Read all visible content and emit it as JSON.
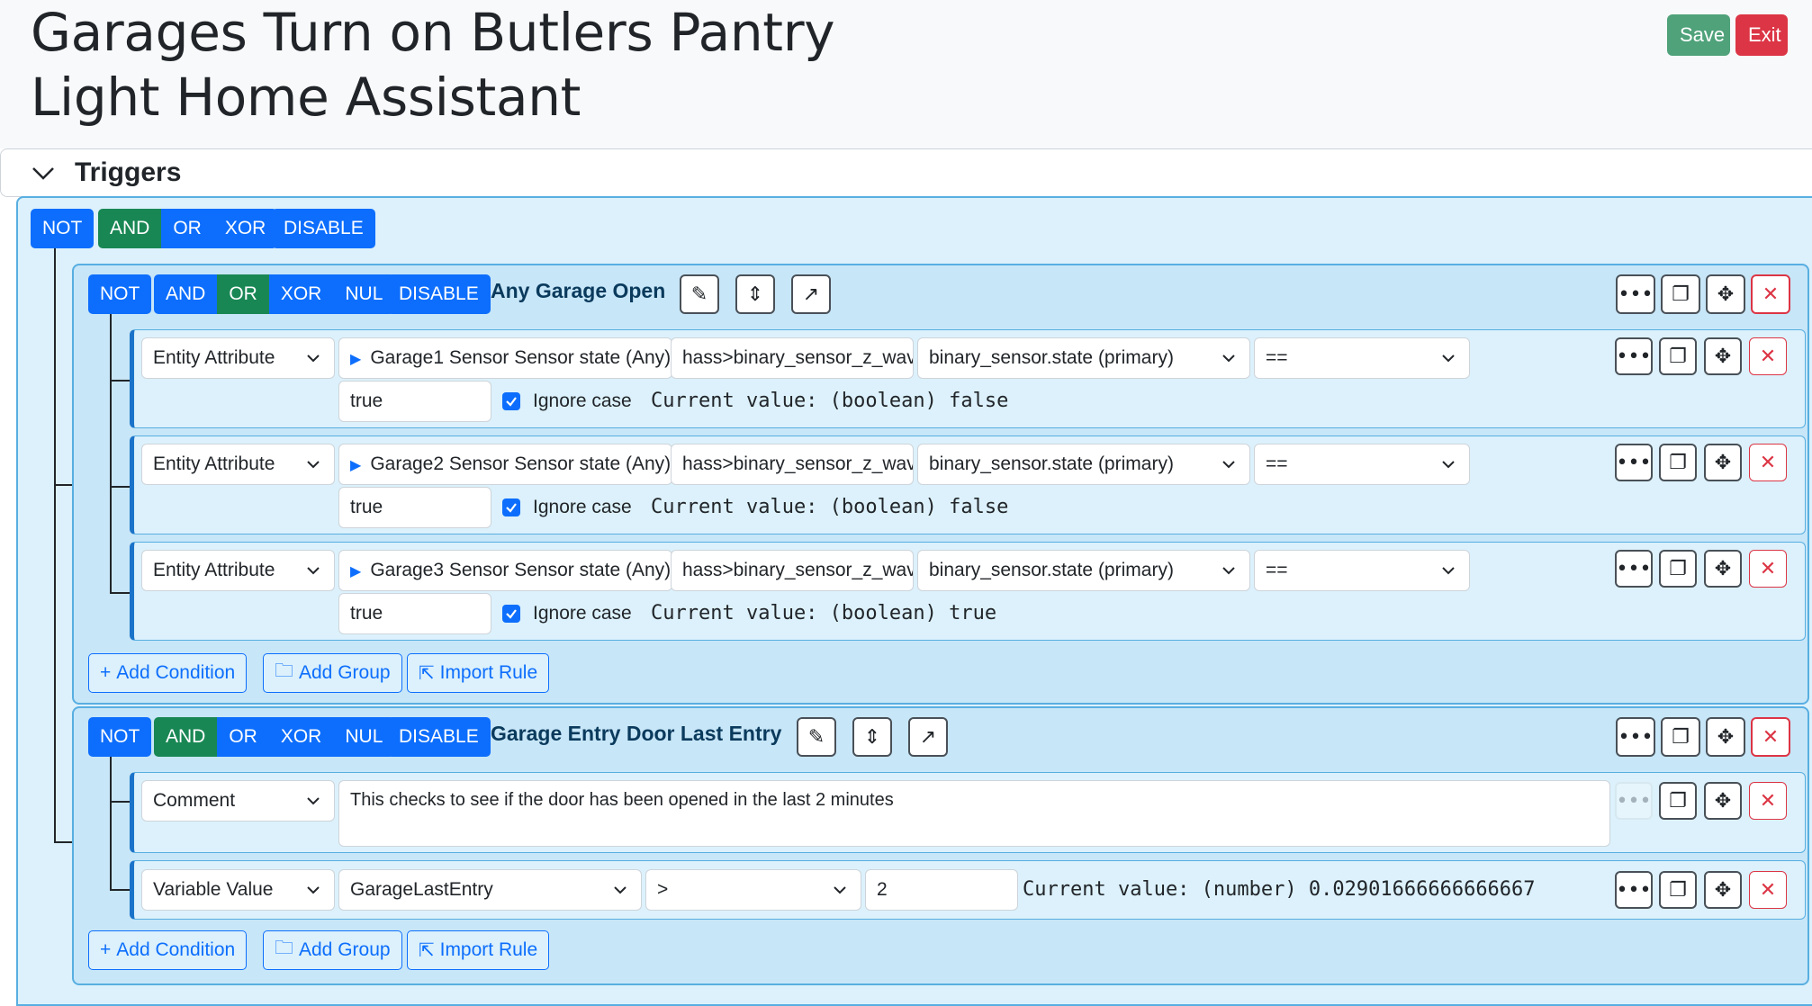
{
  "header": {
    "title_line1": "Garages Turn on Butlers Pantry",
    "title_line2": "Light Home Assistant",
    "save_label": "Save",
    "exit_label": "Exit"
  },
  "triggers": {
    "label": "Triggers"
  },
  "root_ops": {
    "not": "NOT",
    "and": "AND",
    "or": "OR",
    "xor": "XOR",
    "disable": "DISABLE",
    "active": "AND"
  },
  "groups": [
    {
      "name": "Any Garage Open",
      "ops": {
        "not": "NOT",
        "and": "AND",
        "or": "OR",
        "xor": "XOR",
        "nul": "NUL",
        "disable": "DISABLE"
      },
      "active": "OR",
      "conditions": [
        {
          "type": "Entity Attribute",
          "entity": "Garage1 Sensor Sensor state (Any)",
          "entity_id": "hass>binary_sensor_z_wav",
          "attribute": "binary_sensor.state (primary)",
          "operator": "==",
          "value": "true",
          "ignore_case": "Ignore case",
          "current_value": "Current value: (boolean) false"
        },
        {
          "type": "Entity Attribute",
          "entity": "Garage2 Sensor Sensor state (Any)",
          "entity_id": "hass>binary_sensor_z_wav",
          "attribute": "binary_sensor.state (primary)",
          "operator": "==",
          "value": "true",
          "ignore_case": "Ignore case",
          "current_value": "Current value: (boolean) false"
        },
        {
          "type": "Entity Attribute",
          "entity": "Garage3 Sensor Sensor state (Any)",
          "entity_id": "hass>binary_sensor_z_wav",
          "attribute": "binary_sensor.state (primary)",
          "operator": "==",
          "value": "true",
          "ignore_case": "Ignore case",
          "current_value": "Current value: (boolean) true"
        }
      ]
    },
    {
      "name": "Garage Entry Door Last Entry",
      "ops": {
        "not": "NOT",
        "and": "AND",
        "or": "OR",
        "xor": "XOR",
        "nul": "NUL",
        "disable": "DISABLE"
      },
      "active": "AND",
      "comment": {
        "type": "Comment",
        "text": "This checks to see if the door has been opened in the last 2 minutes"
      },
      "variable": {
        "type": "Variable Value",
        "name": "GarageLastEntry",
        "operator": ">",
        "value": "2",
        "current_value": "Current value: (number) 0.02901666666666667"
      }
    }
  ],
  "actions": {
    "add_condition": "Add Condition",
    "add_group": "Add Group",
    "import_rule": "Import Rule"
  },
  "colors": {
    "primary": "#0d6efd",
    "active": "#198754",
    "save": "#4fa27a",
    "exit": "#dc3545",
    "group_bg": "#c7e6f8",
    "root_bg": "#dcf1fb"
  }
}
